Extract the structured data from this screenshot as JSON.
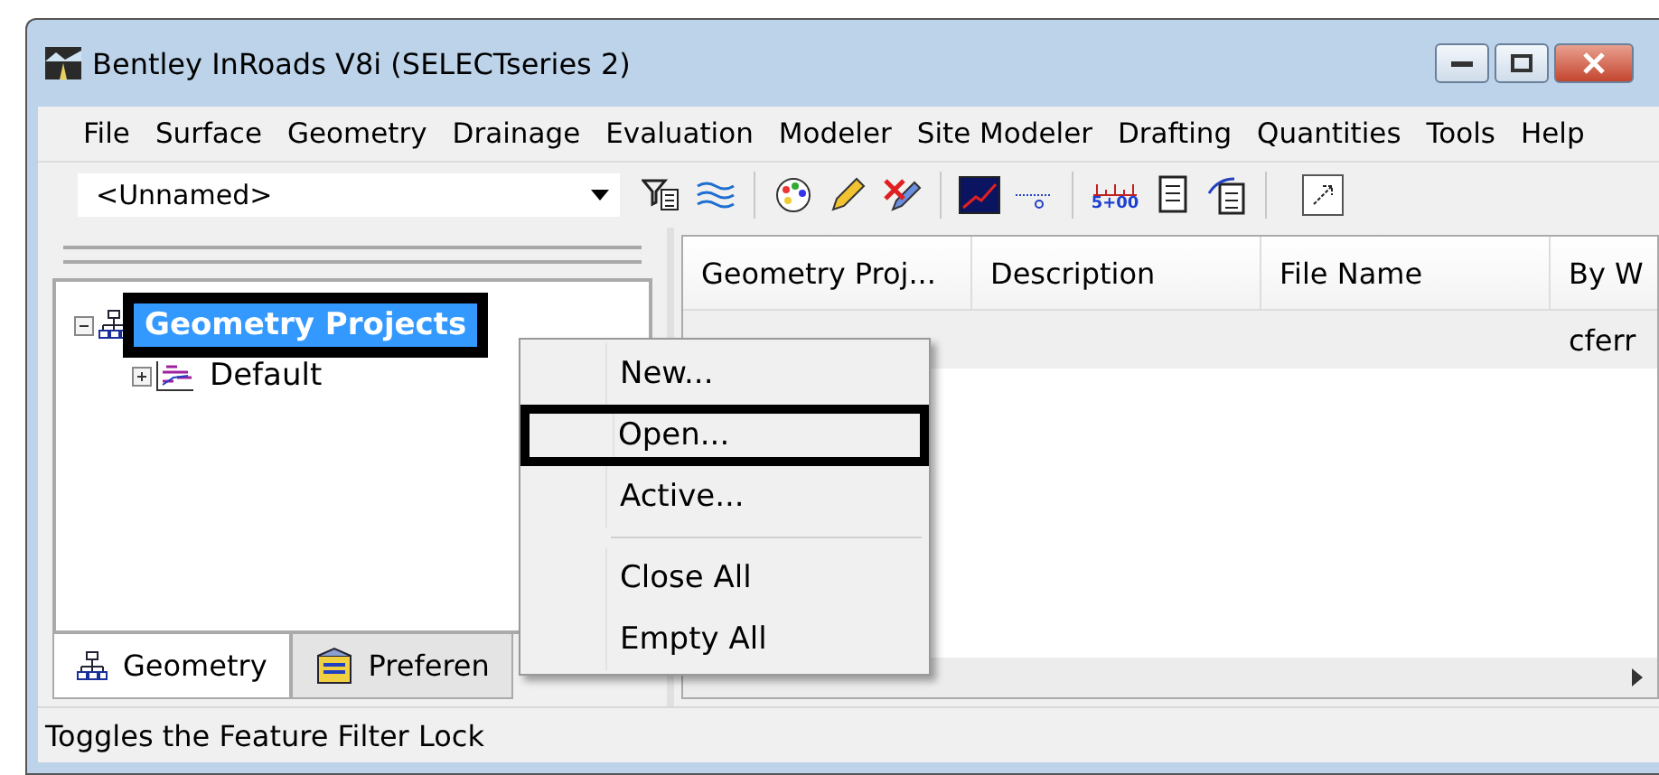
{
  "window": {
    "title": "Bentley InRoads V8i (SELECTseries 2)"
  },
  "menu_bar": [
    "File",
    "Surface",
    "Geometry",
    "Drainage",
    "Evaluation",
    "Modeler",
    "Site Modeler",
    "Drafting",
    "Quantities",
    "Tools",
    "Help"
  ],
  "toolbar": {
    "project_dropdown": "<Unnamed>",
    "station_label": "5+00"
  },
  "tree": {
    "items": [
      {
        "label": "Geometry Projects",
        "selected": true,
        "expanded": true,
        "children": [
          {
            "label": "Default",
            "selected": false,
            "expanded": false
          }
        ]
      }
    ]
  },
  "tabs": [
    {
      "label": "Geometry",
      "selected": true
    },
    {
      "label": "Preferen",
      "selected": false
    }
  ],
  "list": {
    "columns": [
      "Geometry Proj...",
      "Description",
      "File Name",
      "By W"
    ],
    "rows": [
      {
        "col_4": "cferr"
      }
    ]
  },
  "context_menu": {
    "items": [
      {
        "label": "New...",
        "highlighted": false,
        "separator_after": false
      },
      {
        "label": "Open...",
        "highlighted": true,
        "separator_after": false
      },
      {
        "label": "Active...",
        "highlighted": false,
        "separator_after": true
      },
      {
        "label": "Close All",
        "highlighted": false,
        "separator_after": false
      },
      {
        "label": "Empty All",
        "highlighted": false,
        "separator_after": false
      }
    ]
  },
  "status_bar": "Toggles the Feature Filter Lock"
}
